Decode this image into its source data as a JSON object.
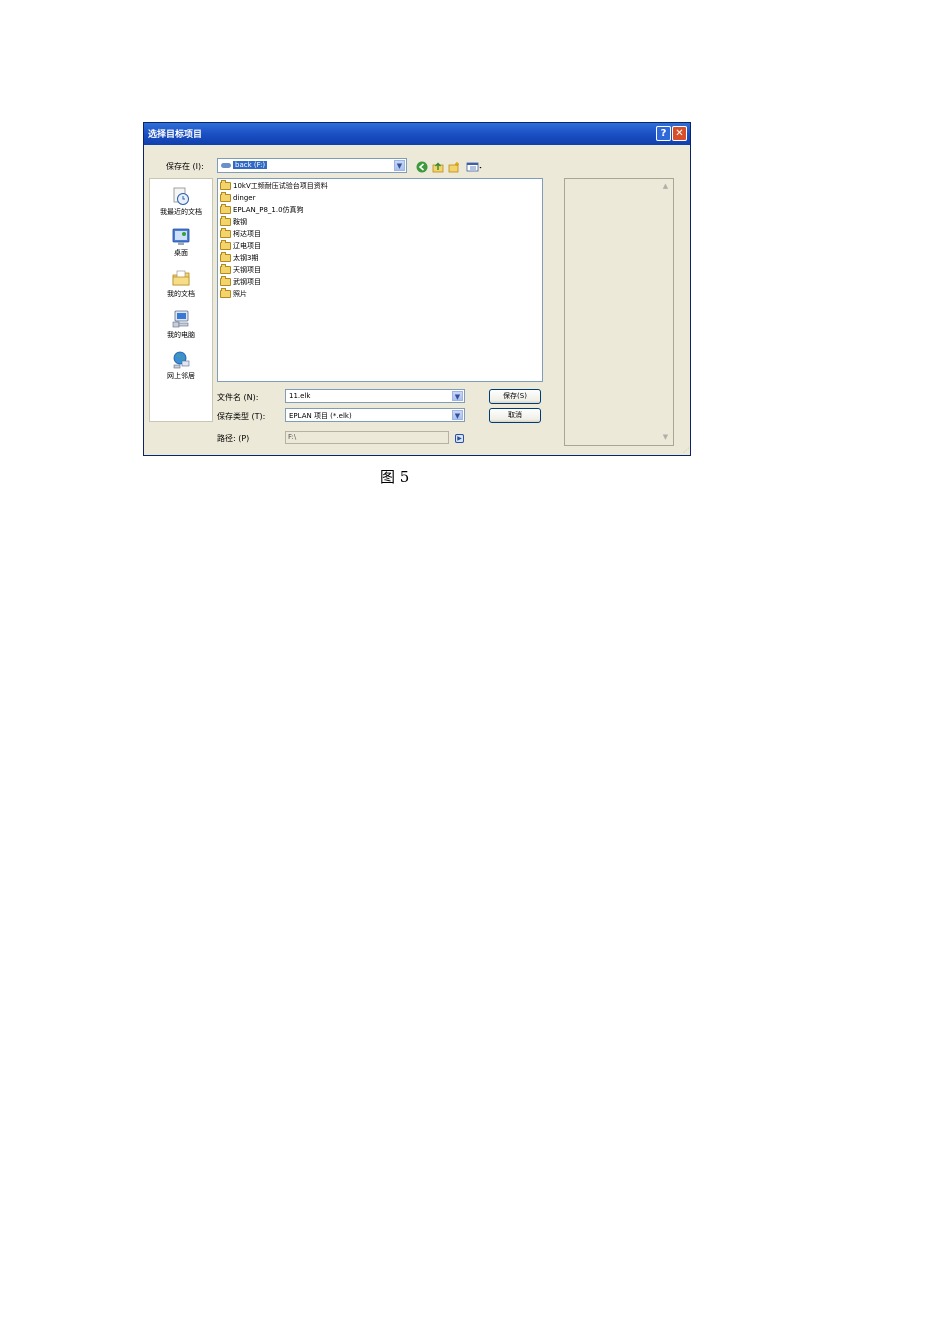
{
  "dialog": {
    "title": "选择目标项目",
    "help_glyph": "?",
    "close_glyph": "✕"
  },
  "save_in": {
    "label": "保存在 (I):",
    "value": "back (F:)"
  },
  "toolbar": {
    "back_icon": "back-icon",
    "up_icon": "up-folder-icon",
    "new_folder_icon": "new-folder-icon",
    "views_icon": "views-menu-icon"
  },
  "places": [
    {
      "label": "我最近的文档",
      "icon": "recent-documents-icon"
    },
    {
      "label": "桌面",
      "icon": "desktop-icon"
    },
    {
      "label": "我的文档",
      "icon": "my-documents-icon"
    },
    {
      "label": "我的电脑",
      "icon": "my-computer-icon"
    },
    {
      "label": "网上邻居",
      "icon": "network-places-icon"
    }
  ],
  "folders": [
    "10kV工频耐压试验台项目资料",
    "dinger",
    "EPLAN_P8_1.0仿真狗",
    "鞍钢",
    "柯达项目",
    "辽电项目",
    "太钢3期",
    "天钢项目",
    "武钢项目",
    "照片"
  ],
  "file_name": {
    "label": "文件名 (N):",
    "value": "11.elk"
  },
  "file_type": {
    "label": "保存类型 (T):",
    "value": "EPLAN 项目 (*.elk)"
  },
  "path": {
    "label": "路径: (P)",
    "value": "F:\\"
  },
  "buttons": {
    "save": "保存(S)",
    "cancel": "取消"
  },
  "caption": "图 5",
  "colors": {
    "titlebar": "#1b4fc3",
    "dialog_bg": "#ece9d8",
    "selection": "#316ac5"
  }
}
